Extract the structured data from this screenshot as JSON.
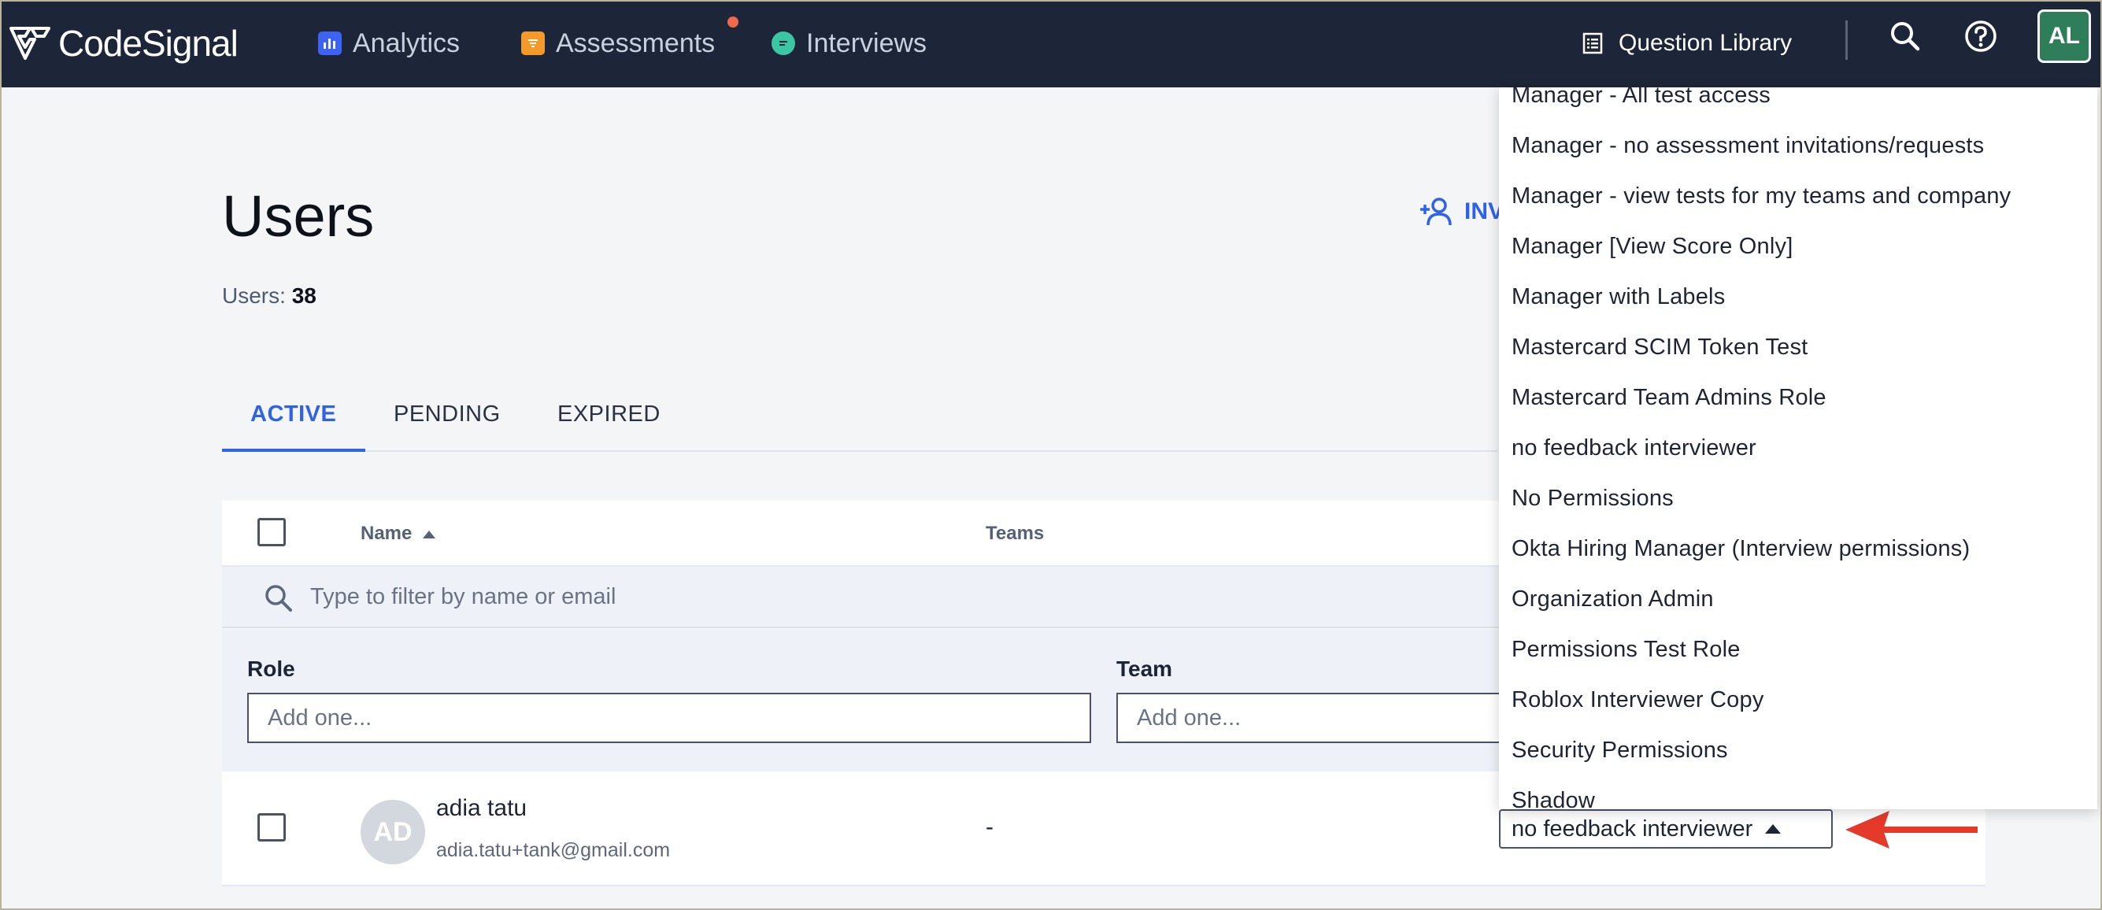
{
  "nav": {
    "logo_text": "CodeSignal",
    "items": [
      {
        "label": "Analytics",
        "icon": "bar-chart-icon",
        "color": "#3d63f2"
      },
      {
        "label": "Assessments",
        "icon": "assessment-icon",
        "color": "#f49a2b",
        "has_badge": true
      },
      {
        "label": "Interviews",
        "icon": "chat-bubble-icon",
        "color": "#3bc7a4"
      }
    ],
    "question_library": "Question Library",
    "avatar_initials": "AL"
  },
  "page": {
    "title": "Users",
    "count_label": "Users:",
    "count_value": "38",
    "invite_label": "INV"
  },
  "tabs": [
    {
      "label": "ACTIVE",
      "active": true
    },
    {
      "label": "PENDING",
      "active": false
    },
    {
      "label": "EXPIRED",
      "active": false
    }
  ],
  "table": {
    "columns": {
      "name": "Name",
      "teams": "Teams"
    },
    "filter_placeholder": "Type to filter by name or email",
    "role_label": "Role",
    "role_placeholder": "Add one...",
    "team_label": "Team",
    "team_placeholder": "Add one...",
    "rows": [
      {
        "initials": "AD",
        "name": "adia tatu",
        "email": "adia.tatu+tank@gmail.com",
        "teams": "-",
        "role": "no feedback interviewer"
      }
    ]
  },
  "dropdown": {
    "options": [
      "Manager - All test access",
      "Manager - no assessment invitations/requests",
      "Manager - view tests for my teams and company",
      "Manager [View Score Only]",
      "Manager with Labels",
      "Mastercard SCIM Token Test",
      "Mastercard Team Admins Role",
      "no feedback interviewer",
      "No Permissions",
      "Okta Hiring Manager (Interview permissions)",
      "Organization Admin",
      "Permissions Test Role",
      "Roblox Interviewer Copy",
      "Security Permissions",
      "Shadow"
    ]
  },
  "colors": {
    "nav_bg": "#1d2638",
    "accent": "#2f62e6",
    "annotation_arrow": "#e53a2a"
  }
}
